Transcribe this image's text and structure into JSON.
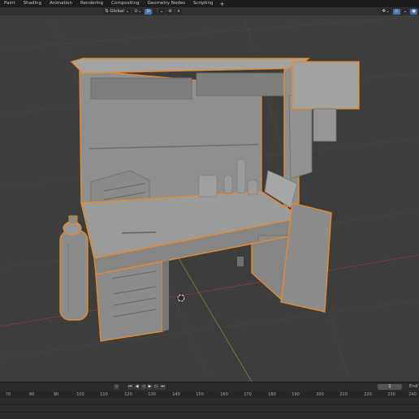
{
  "workspace_tabs": [
    "Paint",
    "Shading",
    "Animation",
    "Rendering",
    "Compositing",
    "Geometry Nodes",
    "Scripting"
  ],
  "header": {
    "orientation": "Global"
  },
  "timeline": {
    "current_frame": "1",
    "end_label": "End",
    "ruler_ticks": [
      "70",
      "80",
      "90",
      "100",
      "110",
      "120",
      "130",
      "140",
      "150",
      "160",
      "170",
      "180",
      "190",
      "200",
      "210",
      "220",
      "230",
      "240"
    ]
  },
  "colors": {
    "viewport_bg": "#3d3d3d",
    "selection_outline": "#e8892a",
    "x_axis": "#8a3a3a",
    "y_axis": "#6c8a3a"
  },
  "icons": [
    "snap-icon",
    "proportional-edit-icon",
    "overlay-icon",
    "shading-mode-icon",
    "play-icon",
    "reverse-play-icon",
    "jump-start-icon",
    "jump-end-icon",
    "keyframe-prev-icon",
    "keyframe-next-icon",
    "3d-cursor-icon"
  ]
}
